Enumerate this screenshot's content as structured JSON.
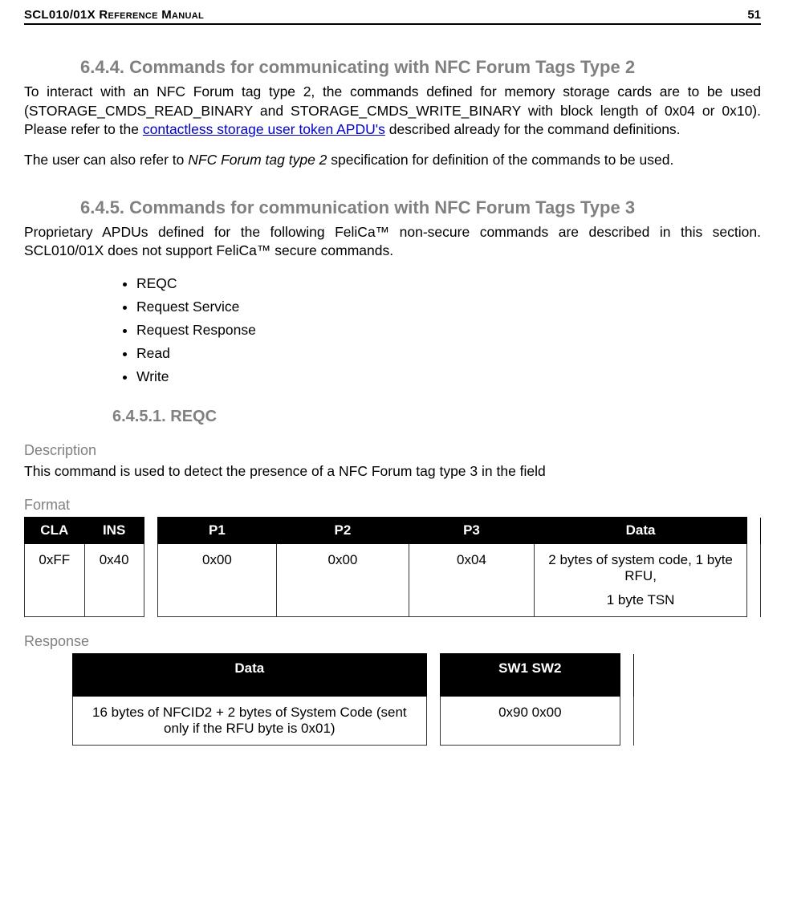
{
  "header": {
    "doc_title": "SCL010/01X Reference Manual",
    "page_num": "51"
  },
  "s644": {
    "heading": "6.4.4.  Commands for communicating with NFC Forum Tags Type 2",
    "para1_a": "To interact with an NFC Forum tag type 2, the commands defined for memory storage cards are to be used (STORAGE_CMDS_READ_BINARY and STORAGE_CMDS_WRITE_BINARY with block length of 0x04 or 0x10). Please refer to the ",
    "para1_link": "contactless storage user token APDU's",
    "para1_b": " described already for the command definitions.",
    "para2_a": "The user can also refer to ",
    "para2_i": "NFC Forum tag type 2",
    "para2_b": " specification for definition of the commands to be used."
  },
  "s645": {
    "heading": "6.4.5.  Commands for communication with NFC Forum Tags Type 3",
    "para1": "Proprietary APDUs defined for the following FeliCa™ non-secure commands are described in this section. SCL010/01X does not support FeliCa™ secure commands.",
    "bullets": [
      "REQC",
      "Request Service",
      "Request Response",
      "Read",
      "Write"
    ]
  },
  "s6451": {
    "heading": "6.4.5.1.    REQC",
    "desc_label": "Description",
    "desc_text": "This command is used to detect the presence of a NFC Forum tag type 3 in the field",
    "format_label": "Format",
    "format_headers": [
      "CLA",
      "INS",
      "P1",
      "P2",
      "P3",
      "Data"
    ],
    "format_row": {
      "cla": "0xFF",
      "ins": "0x40",
      "p1": "0x00",
      "p2": "0x00",
      "p3": "0x04",
      "data_l1": "2 bytes of system code, 1 byte RFU,",
      "data_l2": "1 byte TSN"
    },
    "response_label": "Response",
    "response_headers": [
      "Data",
      "SW1 SW2"
    ],
    "response_row": {
      "data": "16 bytes of NFCID2 + 2 bytes of System Code (sent only if the RFU byte is 0x01)",
      "sw": "0x90 0x00"
    }
  }
}
